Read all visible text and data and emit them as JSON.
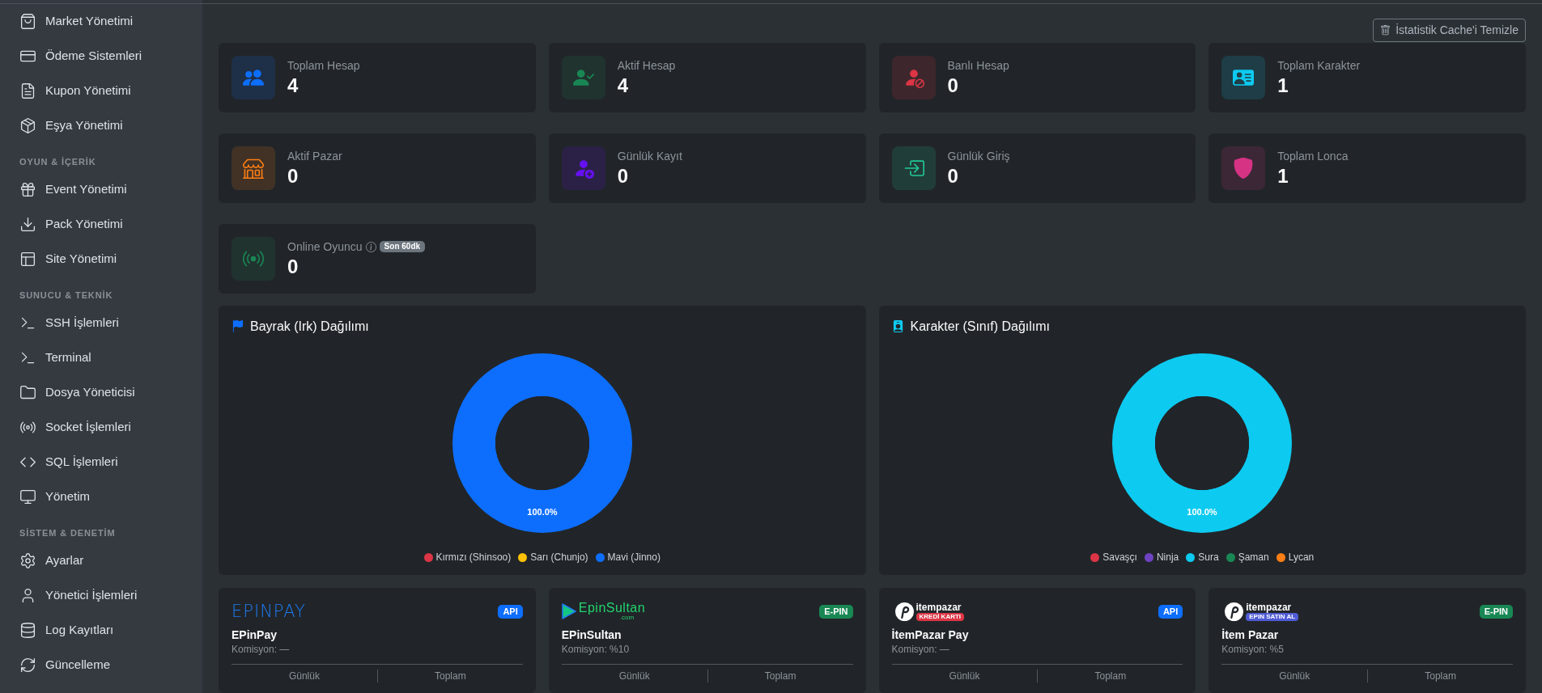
{
  "sidebar": {
    "sections": [
      {
        "items": [
          {
            "label": "Market Yönetimi",
            "selected": false
          },
          {
            "label": "Ödeme Sistemleri",
            "selected": false
          },
          {
            "label": "Kupon Yönetimi",
            "selected": false
          },
          {
            "label": "Eşya Yönetimi",
            "selected": false
          }
        ]
      },
      {
        "title": "OYUN & İÇERİK",
        "items": [
          {
            "label": "Event Yönetimi",
            "selected": false
          },
          {
            "label": "Pack Yönetimi",
            "selected": false
          },
          {
            "label": "Site Yönetimi",
            "selected": false
          }
        ]
      },
      {
        "title": "SUNUCU & TEKNİK",
        "items": [
          {
            "label": "SSH İşlemleri",
            "selected": false
          },
          {
            "label": "Terminal",
            "selected": false
          },
          {
            "label": "Dosya Yöneticisi",
            "selected": false
          },
          {
            "label": "Socket İşlemleri",
            "selected": false
          },
          {
            "label": "SQL İşlemleri",
            "selected": false
          },
          {
            "label": "Yönetim",
            "selected": false
          }
        ]
      },
      {
        "title": "SİSTEM & DENETİM",
        "items": [
          {
            "label": "Ayarlar",
            "selected": false
          },
          {
            "label": "Yönetici İşlemleri",
            "selected": false
          },
          {
            "label": "Log Kayıtları",
            "selected": false
          },
          {
            "label": "Güncelleme",
            "selected": false
          }
        ]
      }
    ]
  },
  "toolbar": {
    "clear_cache_button": "İstatistik Cache'i Temizle"
  },
  "stats": [
    {
      "label": "Toplam Hesap",
      "value": "4",
      "color": "#0d6efd",
      "info": false
    },
    {
      "label": "Aktif Hesap",
      "value": "4",
      "color": "#198754",
      "info": false
    },
    {
      "label": "Banlı Hesap",
      "value": "0",
      "color": "#dc3545",
      "info": false
    },
    {
      "label": "Toplam Karakter",
      "value": "1",
      "color": "#0dcaf0",
      "info": false
    },
    {
      "label": "Aktif Pazar",
      "value": "0",
      "color": "#fd7e14",
      "info": false
    },
    {
      "label": "Günlük Kayıt",
      "value": "0",
      "color": "#6610f2",
      "info": false
    },
    {
      "label": "Günlük Giriş",
      "value": "0",
      "color": "#20c997",
      "info": false
    },
    {
      "label": "Toplam Lonca",
      "value": "1",
      "color": "#d63384",
      "info": false
    },
    {
      "label": "Online Oyuncu",
      "value": "0",
      "color": "#198754",
      "info": true,
      "badge": "Son 60dk"
    }
  ],
  "charts": [
    {
      "chart_data": {
        "type": "donut",
        "title": "Bayrak (Irk) Dağılımı",
        "categories": [
          "Kırmızı (Shinsoo)",
          "Sarı (Chunjo)",
          "Mavi (Jinno)"
        ],
        "values": [
          0,
          0,
          1
        ],
        "colors": [
          "#dc3545",
          "#ffc107",
          "#0d6efd"
        ],
        "value_labels": [
          null,
          null,
          "100.0%"
        ]
      }
    },
    {
      "chart_data": {
        "type": "donut",
        "title": "Karakter (Sınıf) Dağılımı",
        "categories": [
          "Savaşçı",
          "Ninja",
          "Sura",
          "Şaman",
          "Lycan"
        ],
        "values": [
          0,
          0,
          1,
          0,
          0
        ],
        "colors": [
          "#dc3545",
          "#6f42c1",
          "#0dcaf0",
          "#198754",
          "#fd7e14"
        ],
        "value_labels": [
          null,
          null,
          "100.0%",
          null,
          null
        ]
      }
    }
  ],
  "providers": [
    {
      "logo": {
        "kind": "epinpay",
        "text": "EPINPAY"
      },
      "badge": {
        "text": "API",
        "color": "#0d6efd"
      },
      "name": "EPinPay",
      "commission": "Komisyon: —",
      "columns": [
        "Günlük",
        "Toplam"
      ]
    },
    {
      "logo": {
        "kind": "epinsultan",
        "text": "EpinSultan",
        "sub": ".com"
      },
      "badge": {
        "text": "E-PIN",
        "color": "#198754"
      },
      "name": "EPinSultan",
      "commission": "Komisyon: %10",
      "columns": [
        "Günlük",
        "Toplam"
      ]
    },
    {
      "logo": {
        "kind": "itempazar",
        "text": "itempazar",
        "tag": {
          "text": "KREDİ KARTI",
          "color": "#dc3545"
        }
      },
      "badge": {
        "text": "API",
        "color": "#0d6efd"
      },
      "name": "İtemPazar Pay",
      "commission": "Komisyon: —",
      "columns": [
        "Günlük",
        "Toplam"
      ]
    },
    {
      "logo": {
        "kind": "itempazar",
        "text": "itempazar",
        "tag": {
          "text": "EPIN SATIN AL",
          "color": "#4f5bd5"
        }
      },
      "badge": {
        "text": "E-PIN",
        "color": "#198754"
      },
      "name": "İtem Pazar",
      "commission": "Komisyon: %5",
      "columns": [
        "Günlük",
        "Toplam"
      ]
    }
  ]
}
